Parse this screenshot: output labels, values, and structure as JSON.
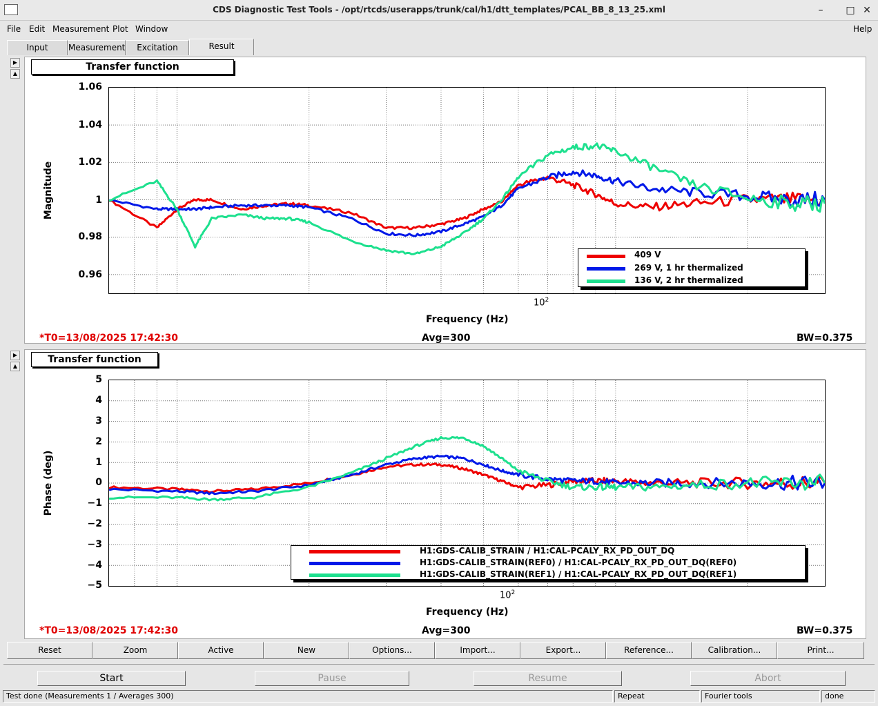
{
  "window": {
    "title": "CDS Diagnostic Test Tools - /opt/rtcds/userapps/trunk/cal/h1/dtt_templates/PCAL_BB_8_13_25.xml",
    "minimize": "–",
    "maximize": "□",
    "close": "✕"
  },
  "menu": {
    "file": "File",
    "edit": "Edit",
    "measurement": "Measurement",
    "plot": "Plot",
    "window": "Window",
    "help": "Help"
  },
  "tabs": {
    "input": "Input",
    "measurement": "Measurement",
    "excitation": "Excitation",
    "result": "Result"
  },
  "panel1": {
    "heading": "Transfer function",
    "ylabel": "Magnitude",
    "xlabel": "Frequency (Hz)",
    "yticks": [
      "1.06",
      "1.04",
      "1.02",
      "1",
      "0.98",
      "0.96"
    ],
    "xtick_base": "10",
    "xtick_exp": "2",
    "t0": "*T0=13/08/2025 17:42:30",
    "avg": "Avg=300",
    "bw": "BW=0.375",
    "legend": [
      "409 V",
      "269 V, 1 hr thermalized",
      "136 V, 2 hr thermalized"
    ]
  },
  "panel2": {
    "heading": "Transfer function",
    "ylabel": "Phase (deg)",
    "xlabel": "Frequency (Hz)",
    "yticks": [
      "5",
      "4",
      "3",
      "2",
      "1",
      "0",
      "−1",
      "−2",
      "−3",
      "−4",
      "−5"
    ],
    "xtick_base": "10",
    "xtick_exp": "2",
    "t0": "*T0=13/08/2025 17:42:30",
    "avg": "Avg=300",
    "bw": "BW=0.375",
    "legend": [
      "H1:GDS-CALIB_STRAIN / H1:CAL-PCALY_RX_PD_OUT_DQ",
      "H1:GDS-CALIB_STRAIN(REF0) / H1:CAL-PCALY_RX_PD_OUT_DQ(REF0)",
      "H1:GDS-CALIB_STRAIN(REF1) / H1:CAL-PCALY_RX_PD_OUT_DQ(REF1)"
    ]
  },
  "colors": {
    "series1": "#ee0000",
    "series2": "#0018e8",
    "series3": "#1de08e"
  },
  "buttons": [
    "Reset",
    "Zoom",
    "Active",
    "New",
    "Options...",
    "Import...",
    "Export...",
    "Reference...",
    "Calibration...",
    "Print..."
  ],
  "controls": {
    "start": "Start",
    "pause": "Pause",
    "resume": "Resume",
    "abort": "Abort"
  },
  "status": {
    "message": "Test done (Measurements 1 / Averages 300)",
    "mode": "Repeat",
    "tool": "Fourier tools",
    "state": "done"
  },
  "chart_data": [
    {
      "type": "line",
      "title": "Transfer function",
      "xlabel": "Frequency (Hz)",
      "ylabel": "Magnitude",
      "xscale": "log",
      "xlim": [
        7,
        300
      ],
      "ylim": [
        0.95,
        1.06
      ],
      "series": [
        {
          "name": "409 V",
          "color": "#ee0000",
          "x": [
            7,
            9,
            10,
            11,
            12,
            14,
            16,
            18,
            20,
            25,
            30,
            35,
            40,
            45,
            50,
            55,
            60,
            70,
            80,
            90,
            100,
            120,
            150,
            200,
            250,
            300
          ],
          "y": [
            1.0,
            0.985,
            0.995,
            1.0,
            1.0,
            0.995,
            0.997,
            0.998,
            0.997,
            0.993,
            0.985,
            0.985,
            0.987,
            0.99,
            0.995,
            0.999,
            1.008,
            1.012,
            1.008,
            1.003,
            0.998,
            0.996,
            0.998,
            1.0,
            1.0,
            1.0
          ]
        },
        {
          "name": "269 V, 1 hr thermalized",
          "color": "#0018e8",
          "x": [
            7,
            9,
            10,
            11,
            12,
            14,
            16,
            18,
            20,
            25,
            30,
            35,
            40,
            45,
            50,
            55,
            60,
            70,
            80,
            90,
            100,
            120,
            150,
            200,
            250,
            300
          ],
          "y": [
            1.0,
            0.995,
            0.995,
            0.995,
            0.996,
            0.997,
            0.997,
            0.997,
            0.996,
            0.99,
            0.982,
            0.981,
            0.983,
            0.987,
            0.991,
            0.997,
            1.006,
            1.012,
            1.015,
            1.013,
            1.01,
            1.006,
            1.004,
            1.002,
            1.0,
            1.0
          ]
        },
        {
          "name": "136 V, 2 hr thermalized",
          "color": "#1de08e",
          "x": [
            7,
            9,
            10,
            11,
            12,
            14,
            16,
            18,
            20,
            25,
            30,
            35,
            40,
            45,
            50,
            55,
            60,
            70,
            80,
            90,
            100,
            120,
            150,
            200,
            250,
            300
          ],
          "y": [
            1.0,
            1.01,
            0.995,
            0.975,
            0.99,
            0.992,
            0.99,
            0.99,
            0.988,
            0.978,
            0.973,
            0.971,
            0.975,
            0.982,
            0.99,
            1.0,
            1.012,
            1.024,
            1.028,
            1.029,
            1.026,
            1.018,
            1.008,
            1.001,
            0.998,
            0.998
          ]
        }
      ]
    },
    {
      "type": "line",
      "title": "Transfer function",
      "xlabel": "Frequency (Hz)",
      "ylabel": "Phase (deg)",
      "xscale": "log",
      "xlim": [
        7,
        300
      ],
      "ylim": [
        -5,
        5
      ],
      "series": [
        {
          "name": "H1:GDS-CALIB_STRAIN / H1:CAL-PCALY_RX_PD_OUT_DQ",
          "color": "#ee0000",
          "x": [
            7,
            10,
            12,
            15,
            20,
            25,
            30,
            35,
            40,
            45,
            50,
            55,
            60,
            70,
            80,
            90,
            100,
            120,
            150,
            200,
            250,
            300
          ],
          "y": [
            -0.2,
            -0.3,
            -0.4,
            -0.3,
            0.0,
            0.4,
            0.8,
            0.9,
            0.9,
            0.7,
            0.4,
            0.1,
            -0.2,
            -0.1,
            0.1,
            0.1,
            0.1,
            0.0,
            0.0,
            0.0,
            0.0,
            0.0
          ]
        },
        {
          "name": "H1:GDS-CALIB_STRAIN(REF0) / H1:CAL-PCALY_RX_PD_OUT_DQ(REF0)",
          "color": "#0018e8",
          "x": [
            7,
            10,
            12,
            15,
            20,
            25,
            30,
            35,
            40,
            45,
            50,
            55,
            60,
            70,
            80,
            90,
            100,
            120,
            150,
            200,
            250,
            300
          ],
          "y": [
            -0.3,
            -0.4,
            -0.5,
            -0.4,
            -0.1,
            0.4,
            0.9,
            1.2,
            1.3,
            1.2,
            0.9,
            0.6,
            0.4,
            0.2,
            0.1,
            0.1,
            0.0,
            0.0,
            0.0,
            0.0,
            0.0,
            0.0
          ]
        },
        {
          "name": "H1:GDS-CALIB_STRAIN(REF1) / H1:CAL-PCALY_RX_PD_OUT_DQ(REF1)",
          "color": "#1de08e",
          "x": [
            7,
            10,
            12,
            15,
            20,
            25,
            30,
            35,
            40,
            45,
            50,
            55,
            60,
            70,
            80,
            90,
            100,
            120,
            150,
            200,
            250,
            300
          ],
          "y": [
            -0.7,
            -0.7,
            -0.8,
            -0.7,
            -0.2,
            0.5,
            1.2,
            1.8,
            2.2,
            2.2,
            1.8,
            1.2,
            0.6,
            0.1,
            -0.2,
            -0.2,
            -0.2,
            -0.2,
            -0.1,
            0.0,
            0.0,
            0.0
          ]
        }
      ]
    }
  ]
}
